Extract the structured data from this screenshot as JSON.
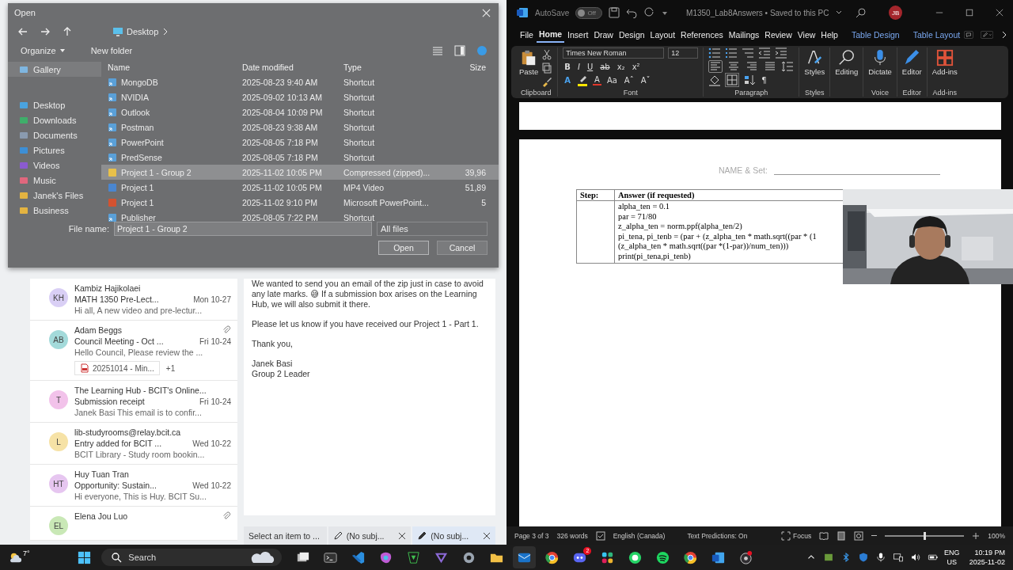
{
  "open_dialog": {
    "title": "Open",
    "breadcrumb": "Desktop",
    "commands": [
      "Organize",
      "New folder"
    ],
    "nav_items": [
      {
        "label": "Gallery",
        "kind": "gallery",
        "selected": true
      },
      {
        "label": "Desktop",
        "kind": "desktop",
        "selected": false
      },
      {
        "label": "Downloads",
        "kind": "downloads",
        "selected": false
      },
      {
        "label": "Documents",
        "kind": "documents",
        "selected": false
      },
      {
        "label": "Pictures",
        "kind": "pictures",
        "selected": false
      },
      {
        "label": "Videos",
        "kind": "videos",
        "selected": false
      },
      {
        "label": "Music",
        "kind": "music",
        "selected": false
      },
      {
        "label": "Janek's Files",
        "kind": "folder",
        "selected": false
      },
      {
        "label": "Business",
        "kind": "folder",
        "selected": false
      }
    ],
    "columns": [
      "Name",
      "Date modified",
      "Type",
      "Size"
    ],
    "rows": [
      {
        "name": "MongoDB",
        "date": "2025-08-23 9:40 AM",
        "type": "Shortcut",
        "kind": "shortcut",
        "selected": false
      },
      {
        "name": "NVIDIA",
        "date": "2025-09-02 10:13 AM",
        "type": "Shortcut",
        "kind": "shortcut",
        "selected": false
      },
      {
        "name": "Outlook",
        "date": "2025-08-04 10:09 PM",
        "type": "Shortcut",
        "kind": "shortcut",
        "selected": false
      },
      {
        "name": "Postman",
        "date": "2025-08-23 9:38 AM",
        "type": "Shortcut",
        "kind": "shortcut",
        "selected": false
      },
      {
        "name": "PowerPoint",
        "date": "2025-08-05 7:18 PM",
        "type": "Shortcut",
        "kind": "shortcut",
        "selected": false
      },
      {
        "name": "PredSense",
        "date": "2025-08-05 7:18 PM",
        "type": "Shortcut",
        "kind": "shortcut",
        "selected": false
      },
      {
        "name": "Project 1 - Group 2",
        "date": "2025-11-02 10:05 PM",
        "type": "Compressed (zipped)...",
        "size": "39,96",
        "kind": "zip",
        "selected": true
      },
      {
        "name": "Project 1",
        "date": "2025-11-02 10:05 PM",
        "type": "MP4 Video",
        "size": "51,89",
        "kind": "video",
        "selected": false
      },
      {
        "name": "Project 1",
        "date": "2025-11-02 9:10 PM",
        "type": "Microsoft PowerPoint...",
        "size": "5",
        "kind": "slides",
        "selected": false
      },
      {
        "name": "Publisher",
        "date": "2025-08-05 7:22 PM",
        "type": "Shortcut",
        "kind": "shortcut",
        "selected": false
      }
    ],
    "file_name_label": "File name:",
    "file_name": "Project 1 - Group 2",
    "filter": "All files",
    "buttons": [
      "Open",
      "Cancel"
    ]
  },
  "outlook": {
    "messages": [
      {
        "initials": "KH",
        "color": "#d9cff5",
        "sender": "Kambiz Hajikolaei",
        "subject": "MATH 1350 Pre-Lect...",
        "date": "Mon 10-27",
        "preview": "Hi all, A new video and pre-lectur...",
        "attachment": false
      },
      {
        "initials": "AB",
        "color": "#a3dada",
        "sender": "Adam Beggs",
        "subject": "Council Meeting - Oct ...",
        "date": "Fri 10-24",
        "preview": "Hello Council, Please review the ...",
        "attachment": true,
        "file": "20251014 - Min...",
        "more": "+1"
      },
      {
        "initials": "T",
        "color": "#f2c2ea",
        "sender": "The Learning Hub - BCIT's Online...",
        "subject": "Submission receipt",
        "date": "Fri 10-24",
        "preview": "Janek Basi This email is to confir...",
        "attachment": false
      },
      {
        "initials": "L",
        "color": "#f6e2a6",
        "sender": "lib-studyrooms@relay.bcit.ca",
        "subject": "Entry added for BCIT ...",
        "date": "Wed 10-22",
        "preview": "BCIT Library - Study room bookin...",
        "attachment": false
      },
      {
        "initials": "HT",
        "color": "#e6c6f0",
        "sender": "Huy Tuan Tran",
        "subject": "Opportunity: Sustain...",
        "date": "Wed 10-22",
        "preview": "Hi everyone, This is Huy. BCIT Su...",
        "attachment": false
      },
      {
        "initials": "EL",
        "color": "#c9e8b6",
        "sender": "Elena Jou Luo",
        "attachment": true
      }
    ],
    "body": [
      "We wanted to send you an email of the zip just in case to avoid any late marks. 😅 If a submission box arises on the Learning Hub, we will also submit it there.",
      "Please let us know if you have received our Project 1 - Part 1.",
      "Thank you,",
      "Janek Basi\nGroup 2 Leader"
    ],
    "tabs": [
      {
        "label": "Select an item to ...",
        "kind": "reading"
      },
      {
        "label": "(No subj...",
        "kind": "draft",
        "selected": false
      },
      {
        "label": "(No subj...",
        "kind": "draft",
        "selected": true
      }
    ]
  },
  "word": {
    "autosave": {
      "label": "AutoSave",
      "on": false,
      "state": "Off"
    },
    "title": "M1350_Lab8Answers • Saved to this PC",
    "user": "JB",
    "tabs": [
      {
        "label": "File",
        "kind": "main",
        "selected": false
      },
      {
        "label": "Home",
        "kind": "main",
        "selected": true
      },
      {
        "label": "Insert",
        "kind": "main",
        "selected": false
      },
      {
        "label": "Draw",
        "kind": "main",
        "selected": false
      },
      {
        "label": "Design",
        "kind": "main",
        "selected": false
      },
      {
        "label": "Layout",
        "kind": "main",
        "selected": false
      },
      {
        "label": "References",
        "kind": "main",
        "selected": false
      },
      {
        "label": "Mailings",
        "kind": "main",
        "selected": false
      },
      {
        "label": "Review",
        "kind": "main",
        "selected": false
      },
      {
        "label": "View",
        "kind": "main",
        "selected": false
      },
      {
        "label": "Help",
        "kind": "main",
        "selected": false
      },
      {
        "label": "Table Design",
        "kind": "contextual",
        "selected": false
      },
      {
        "label": "Table Layout",
        "kind": "contextual",
        "selected": false
      }
    ],
    "font_name": "Times New Roman",
    "font_size": "12",
    "format_buttons": [
      "B",
      "I",
      "U",
      "ab",
      "x₂",
      "x²"
    ],
    "font_tools": [
      {
        "kind": "effects",
        "label": "A"
      },
      {
        "kind": "highlight"
      },
      {
        "kind": "color",
        "label": "A"
      },
      {
        "kind": "case",
        "label": "Aa"
      },
      {
        "kind": "grow",
        "label": "Aˆ"
      },
      {
        "kind": "shrink",
        "label": "Aˇ"
      }
    ],
    "alignment": [
      {
        "kind": "left",
        "selected": true
      },
      {
        "kind": "center",
        "selected": false
      },
      {
        "kind": "right",
        "selected": false
      },
      {
        "kind": "justify",
        "selected": false
      }
    ],
    "pilcrow": "¶",
    "large_buttons": [
      {
        "label": "Paste"
      },
      {
        "label": "Styles"
      },
      {
        "label": "Editing"
      },
      {
        "label": "Dictate"
      },
      {
        "label": "Editor"
      },
      {
        "label": "Add-ins"
      }
    ],
    "group_labels": [
      "Clipboard",
      "Font",
      "Paragraph",
      "Styles",
      "Voice",
      "Editor",
      "Add-ins"
    ],
    "document": {
      "name_label": "NAME & Set:",
      "headers": [
        "Step:",
        "Answer (if requested)"
      ],
      "code_lines": [
        "alpha_ten = 0.1",
        "par = 71/80",
        "z_alpha_ten = norm.ppf(alpha_ten/2)",
        "pi_tena, pi_tenb = (par + (z_alpha_ten * math.sqrt((par * (1",
        "(z_alpha_ten * math.sqrt((par *(1-par))/num_ten)))",
        "print(pi_tena,pi_tenb)"
      ]
    },
    "status": {
      "page": "Page 3 of 3",
      "words": "326 words",
      "language": "English (Canada)",
      "predictions": "Text Predictions: On",
      "focus": "Focus",
      "zoom": "100%",
      "zoom_level": {
        "level": 0.5
      }
    }
  },
  "taskbar": {
    "weather": "7°",
    "search": "Search",
    "badge": "2",
    "language": [
      "ENG",
      "US"
    ],
    "time": "10:19 PM",
    "date": "2025-11-02"
  }
}
